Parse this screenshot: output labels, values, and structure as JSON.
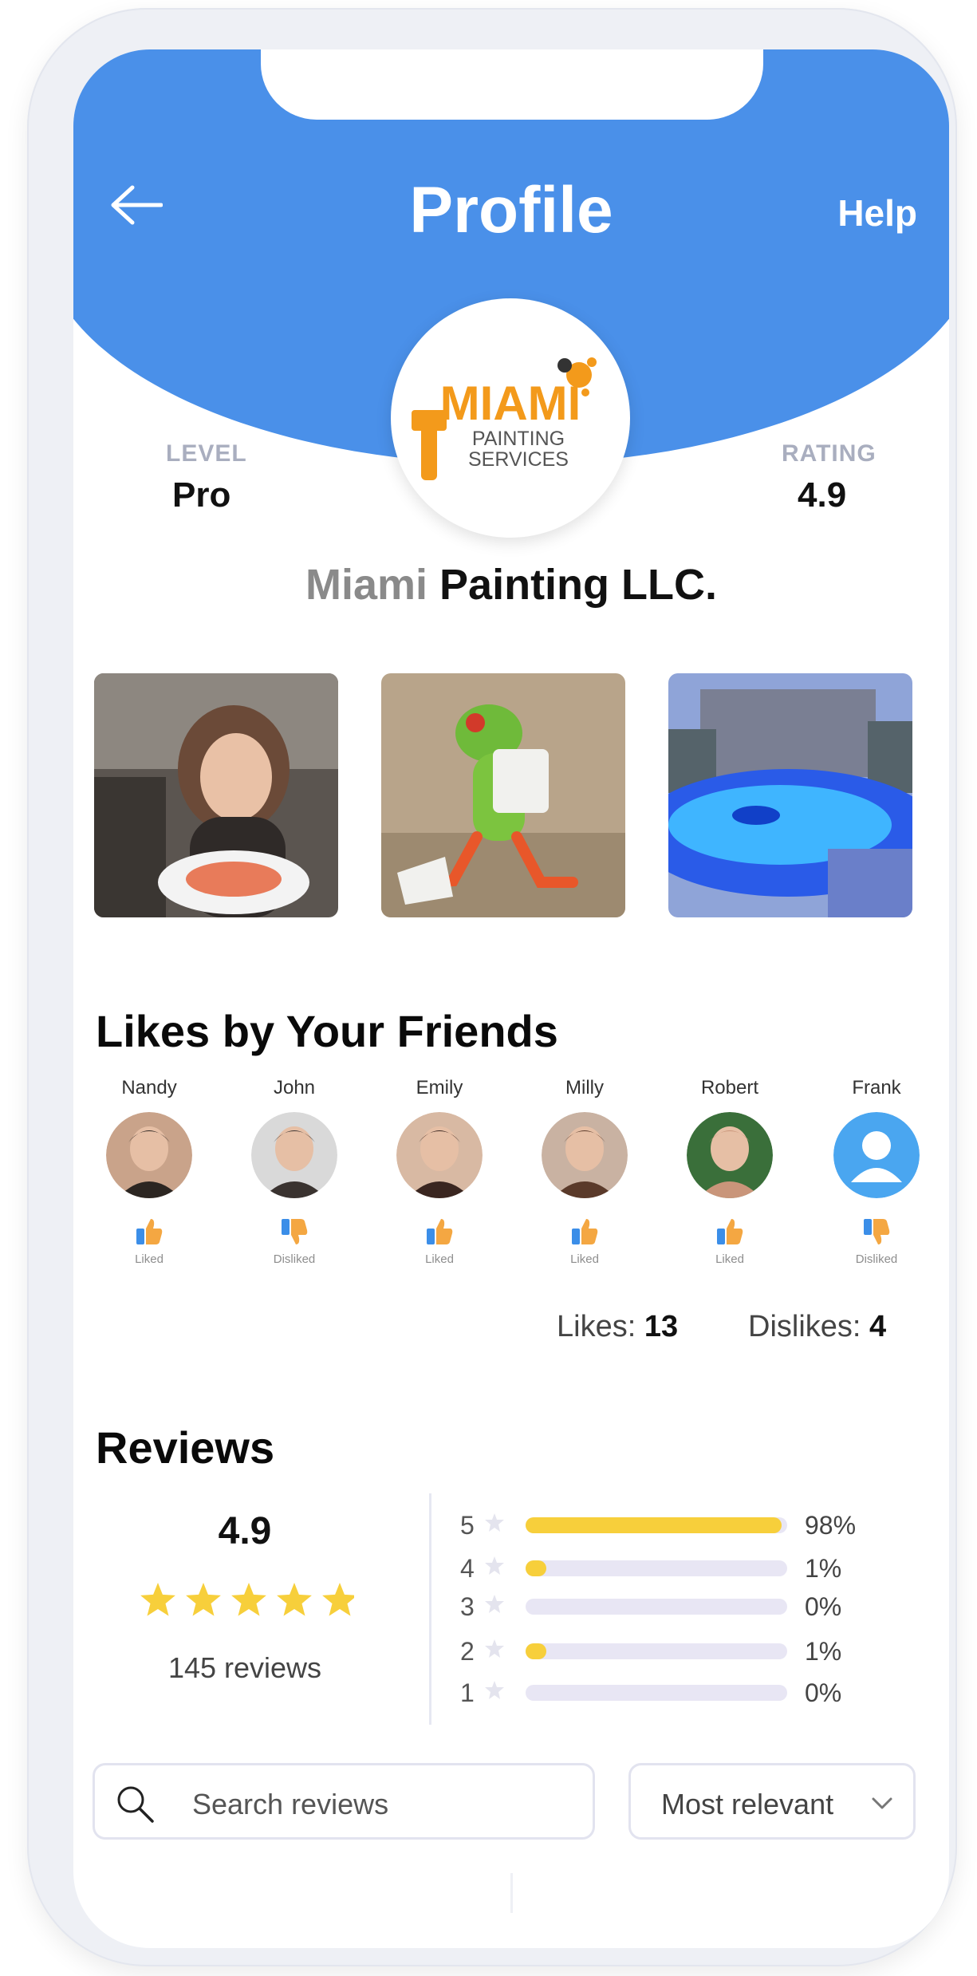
{
  "header": {
    "title": "Profile",
    "help_label": "Help",
    "back_icon": "arrow-left-icon"
  },
  "logo": {
    "line1": "MIAMI",
    "line2": "PAINTING",
    "line3": "SERVICES"
  },
  "stats": {
    "level_label": "LEVEL",
    "level_value": "Pro",
    "rating_label": "RATING",
    "rating_value": "4.9"
  },
  "company": {
    "first": "Miami",
    "rest": " Painting LLC."
  },
  "photos": [
    "woman-with-salmon-plate",
    "toy-frog-painter",
    "illuminated-pool-night"
  ],
  "friends_section": {
    "title": "Likes by Your Friends",
    "friends": [
      {
        "name": "Nandy",
        "status": "Liked",
        "liked": true
      },
      {
        "name": "John",
        "status": "Disliked",
        "liked": false
      },
      {
        "name": "Emily",
        "status": "Liked",
        "liked": true
      },
      {
        "name": "Milly",
        "status": "Liked",
        "liked": true
      },
      {
        "name": "Robert",
        "status": "Liked",
        "liked": true
      },
      {
        "name": "Frank",
        "status": "Disliked",
        "liked": false
      }
    ],
    "likes_label": "Likes:",
    "likes_value": "13",
    "dislikes_label": "Dislikes:",
    "dislikes_value": "4"
  },
  "reviews": {
    "title": "Reviews",
    "average": "4.9",
    "star_count": 5,
    "count_text": "145 reviews",
    "breakdown": [
      {
        "stars": "5",
        "percent": 98,
        "label": "98%"
      },
      {
        "stars": "4",
        "percent": 1,
        "label": "1%"
      },
      {
        "stars": "3",
        "percent": 0,
        "label": "0%"
      },
      {
        "stars": "2",
        "percent": 1,
        "label": "1%"
      },
      {
        "stars": "1",
        "percent": 0,
        "label": "0%"
      }
    ],
    "search_placeholder": "Search reviews",
    "sort_value": "Most relevant"
  },
  "colors": {
    "header_blue": "#4a90e9",
    "star_yellow": "#f7cf3b",
    "logo_orange": "#f39a1b",
    "thumb_blue": "#3b8ee8",
    "thumb_orange": "#f4a742"
  }
}
